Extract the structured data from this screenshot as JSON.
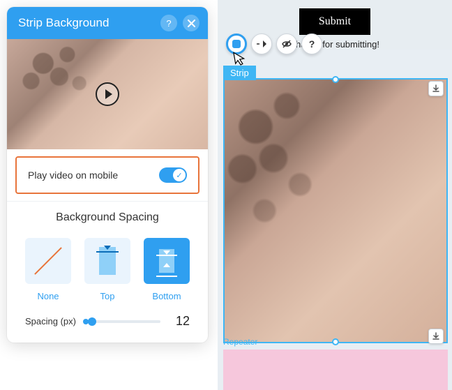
{
  "panel": {
    "title": "Strip Background",
    "toggle_label": "Play video on mobile",
    "section_title": "Background Spacing",
    "options": {
      "none": "None",
      "top": "Top",
      "bottom": "Bottom"
    },
    "spacing_label": "Spacing (px)",
    "spacing_value": "12"
  },
  "canvas": {
    "submit_label": "Submit",
    "thanks": "Thanks for submitting!",
    "strip_tag": "Strip",
    "repeater_tag": "Repeater"
  }
}
